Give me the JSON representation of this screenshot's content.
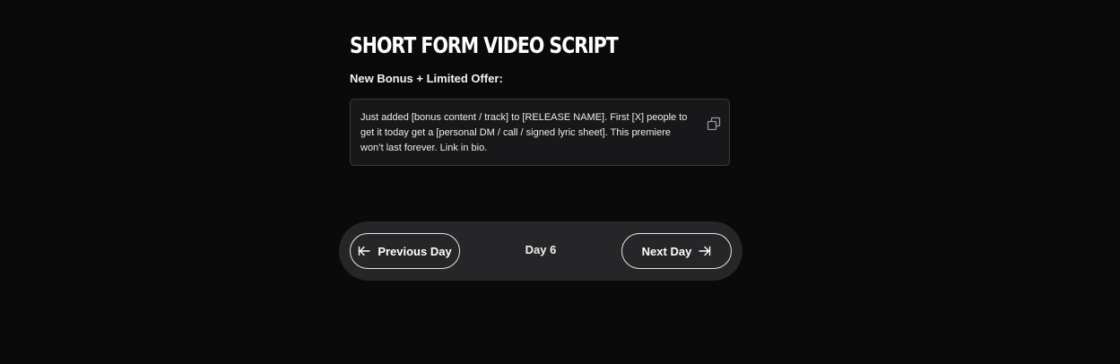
{
  "header": {
    "title": "SHORT FORM VIDEO SCRIPT"
  },
  "section": {
    "label": "New Bonus + Limited Offer:",
    "script_text": "Just added [bonus content / track] to [RELEASE NAME]. First [X] people to get it today get a [personal DM / call / signed lyric sheet]. This premiere won’t last forever. Link in bio.",
    "copy_icon": "copy-icon"
  },
  "navigation": {
    "prev_label": "Previous Day",
    "prev_icon": "arrow-left-icon",
    "day_label": "Day 6",
    "next_label": "Next Day",
    "next_icon": "arrow-right-icon"
  },
  "colors": {
    "background": "#0a0a0b",
    "card_background": "#18181a",
    "nav_background": "#262628",
    "text": "#ffffff"
  }
}
